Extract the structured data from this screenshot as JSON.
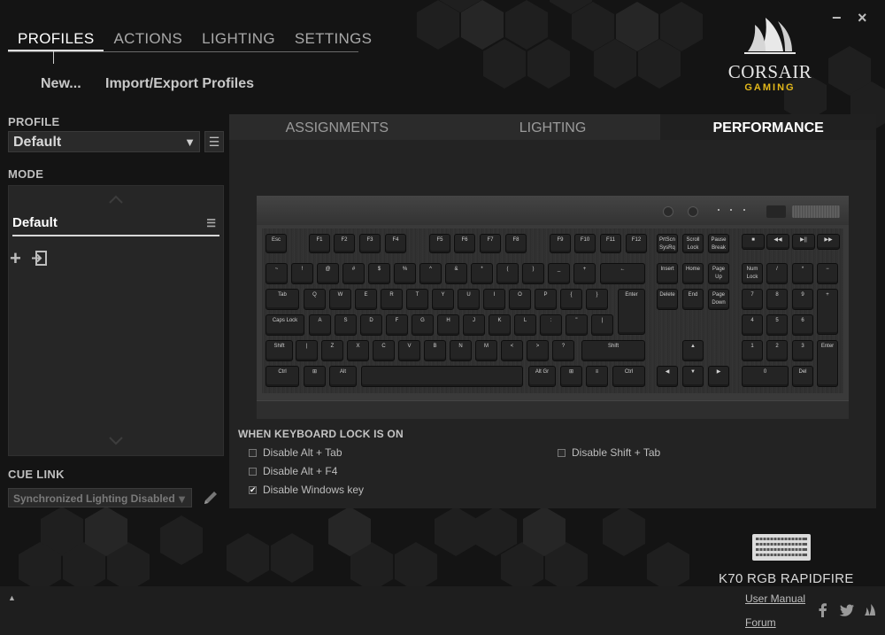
{
  "nav": {
    "tabs": [
      {
        "label": "PROFILES"
      },
      {
        "label": "ACTIONS"
      },
      {
        "label": "LIGHTING"
      },
      {
        "label": "SETTINGS"
      }
    ],
    "new_label": "New...",
    "import_export_label": "Import/Export Profiles"
  },
  "window": {
    "minimize": "−",
    "close": "×"
  },
  "logo": {
    "brand": "CORSAIR",
    "sub": "GAMING",
    "accent_color": "#e3b81a"
  },
  "left": {
    "profile_label": "PROFILE",
    "profile_value": "Default",
    "mode_label": "MODE",
    "mode_item": "Default",
    "cue_link_label": "CUE LINK",
    "cue_link_value": "Synchronized Lighting Disabled"
  },
  "tabs": [
    {
      "label": "ASSIGNMENTS"
    },
    {
      "label": "LIGHTING"
    },
    {
      "label": "PERFORMANCE"
    }
  ],
  "keyboard": {
    "fn_row": [
      "Esc",
      "F1",
      "F2",
      "F3",
      "F4",
      "F5",
      "F6",
      "F7",
      "F8",
      "F9",
      "F10",
      "F11",
      "F12",
      "PrtScn SysRq",
      "Scroll Lock",
      "Pause Break"
    ],
    "num_row": [
      "~",
      "!",
      "@",
      "#",
      "$",
      "%",
      "^",
      "&",
      "*",
      "(",
      ")",
      "_",
      "+",
      "←"
    ],
    "q_row": [
      "Tab",
      "Q",
      "W",
      "E",
      "R",
      "T",
      "Y",
      "U",
      "I",
      "O",
      "P",
      "{",
      "}",
      "Enter"
    ],
    "a_row": [
      "Caps Lock",
      "A",
      "S",
      "D",
      "F",
      "G",
      "H",
      "J",
      "K",
      "L",
      ":",
      "\"",
      "|"
    ],
    "z_row": [
      "Shift",
      "|",
      "Z",
      "X",
      "C",
      "V",
      "B",
      "N",
      "M",
      "<",
      ">",
      "?",
      "Shift"
    ],
    "bottom_row": [
      "Ctrl",
      "⊞",
      "Alt",
      "",
      "Alt Gr",
      "⊞",
      "≡",
      "Ctrl"
    ],
    "nav_cluster": [
      "Insert",
      "Home",
      "Page Up",
      "Delete",
      "End",
      "Page Down"
    ],
    "arrows": [
      "▲",
      "◀",
      "▼",
      "▶"
    ],
    "media": [
      "■",
      "◀◀",
      "▶||",
      "▶▶"
    ],
    "numpad": [
      "Num Lock",
      "/",
      "*",
      "−",
      "7",
      "8",
      "9",
      "+",
      "4",
      "5",
      "6",
      "1",
      "2",
      "3",
      "Enter",
      "0",
      "Del"
    ]
  },
  "performance": {
    "section_title": "WHEN KEYBOARD LOCK IS ON",
    "options": [
      {
        "label": "Disable Alt + Tab",
        "checked": false
      },
      {
        "label": "Disable Alt + F4",
        "checked": false
      },
      {
        "label": "Disable Windows key",
        "checked": true
      },
      {
        "label": "Disable Shift + Tab",
        "checked": false
      }
    ],
    "check_glyph": "✔"
  },
  "device": {
    "name": "K70 RGB RAPIDFIRE"
  },
  "footer": {
    "user_manual": "User Manual",
    "forum": "Forum",
    "collapse_glyph": "▲"
  }
}
